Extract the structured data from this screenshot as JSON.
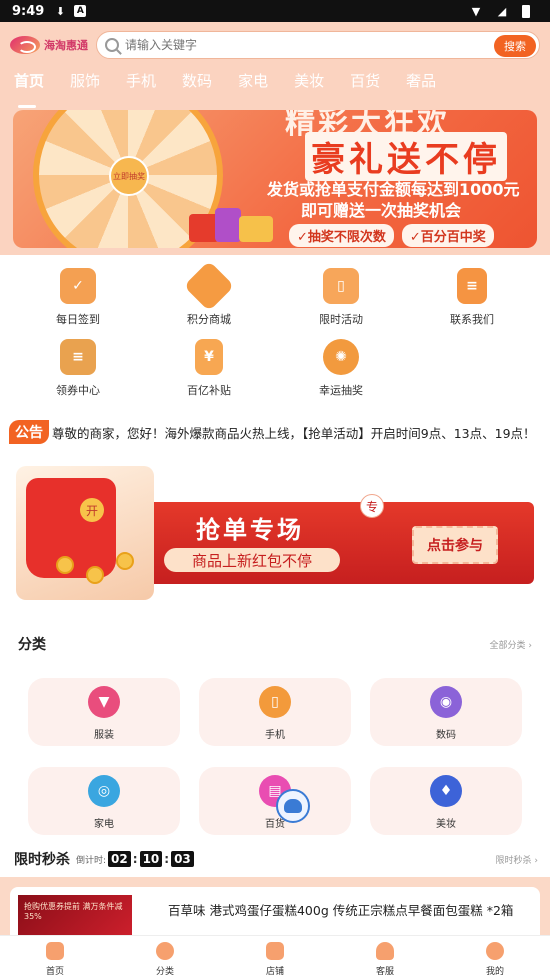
{
  "status_bar": {
    "time": "9:49"
  },
  "header": {
    "logo_text": "海淘惠通",
    "search_placeholder": "请输入关键字",
    "search_button": "搜索",
    "tabs": [
      "首页",
      "服饰",
      "手机",
      "数码",
      "家电",
      "美妆",
      "百货",
      "奢品"
    ]
  },
  "banner": {
    "wheel_center": "立即抽奖",
    "title_top": "精彩大狂欢",
    "title_main": "豪礼送不停",
    "line1": "发货或抢单支付金额每达到1000元",
    "line2": "即可赠送一次抽奖机会",
    "tag1": "✓抽奖不限次数",
    "tag2": "✓百分百中奖"
  },
  "quick_links": [
    {
      "label": "每日签到",
      "icon": "calendar-icon",
      "color": "#f4a052"
    },
    {
      "label": "积分商城",
      "icon": "tag-icon",
      "color": "#f59b42"
    },
    {
      "label": "限时活动",
      "icon": "gift-icon",
      "color": "#f7a65a"
    },
    {
      "label": "联系我们",
      "icon": "contact-icon",
      "color": "#f59442"
    },
    {
      "label": "领券中心",
      "icon": "coupon-icon",
      "color": "#e9a24f"
    },
    {
      "label": "百亿补贴",
      "icon": "yen-icon",
      "color": "#f7a752"
    },
    {
      "label": "幸运抽奖",
      "icon": "wheel-icon",
      "color": "#f29a3e"
    }
  ],
  "notice": {
    "badge": "公告",
    "text": "尊敬的商家，您好！海外爆款商品火热上线，【抢单活动】开启时间9点、13点、19点！"
  },
  "promo": {
    "title": "抢单专场",
    "subtitle": "商品上新红包不停",
    "button": "点击参与",
    "badge": "专",
    "envelope_char": "开"
  },
  "categories": {
    "title": "分类",
    "more": "全部分类",
    "items": [
      {
        "label": "服装",
        "icon": "shirt-icon",
        "color": "#e94d7d"
      },
      {
        "label": "手机",
        "icon": "phone-icon",
        "color": "#f39a3b"
      },
      {
        "label": "数码",
        "icon": "camera-icon",
        "color": "#8b63d8"
      },
      {
        "label": "家电",
        "icon": "washer-icon",
        "color": "#3aa6e0"
      },
      {
        "label": "百货",
        "icon": "tissue-icon",
        "color": "#e94db2"
      },
      {
        "label": "美妆",
        "icon": "lipstick-icon",
        "color": "#3d63d8"
      }
    ]
  },
  "flash_sale": {
    "title": "限时秒杀",
    "countdown_label": "倒计时:",
    "hours": "02",
    "minutes": "10",
    "seconds": "03",
    "more": "限时秒杀"
  },
  "product": {
    "name": "百草味 港式鸡蛋仔蛋糕400g 传统正宗糕点早餐面包蛋糕 *2箱",
    "thumb_text": "抢购优惠券提前 满万条件减35%"
  },
  "bottom_nav": [
    "首页",
    "分类",
    "店铺",
    "客服",
    "我的"
  ]
}
